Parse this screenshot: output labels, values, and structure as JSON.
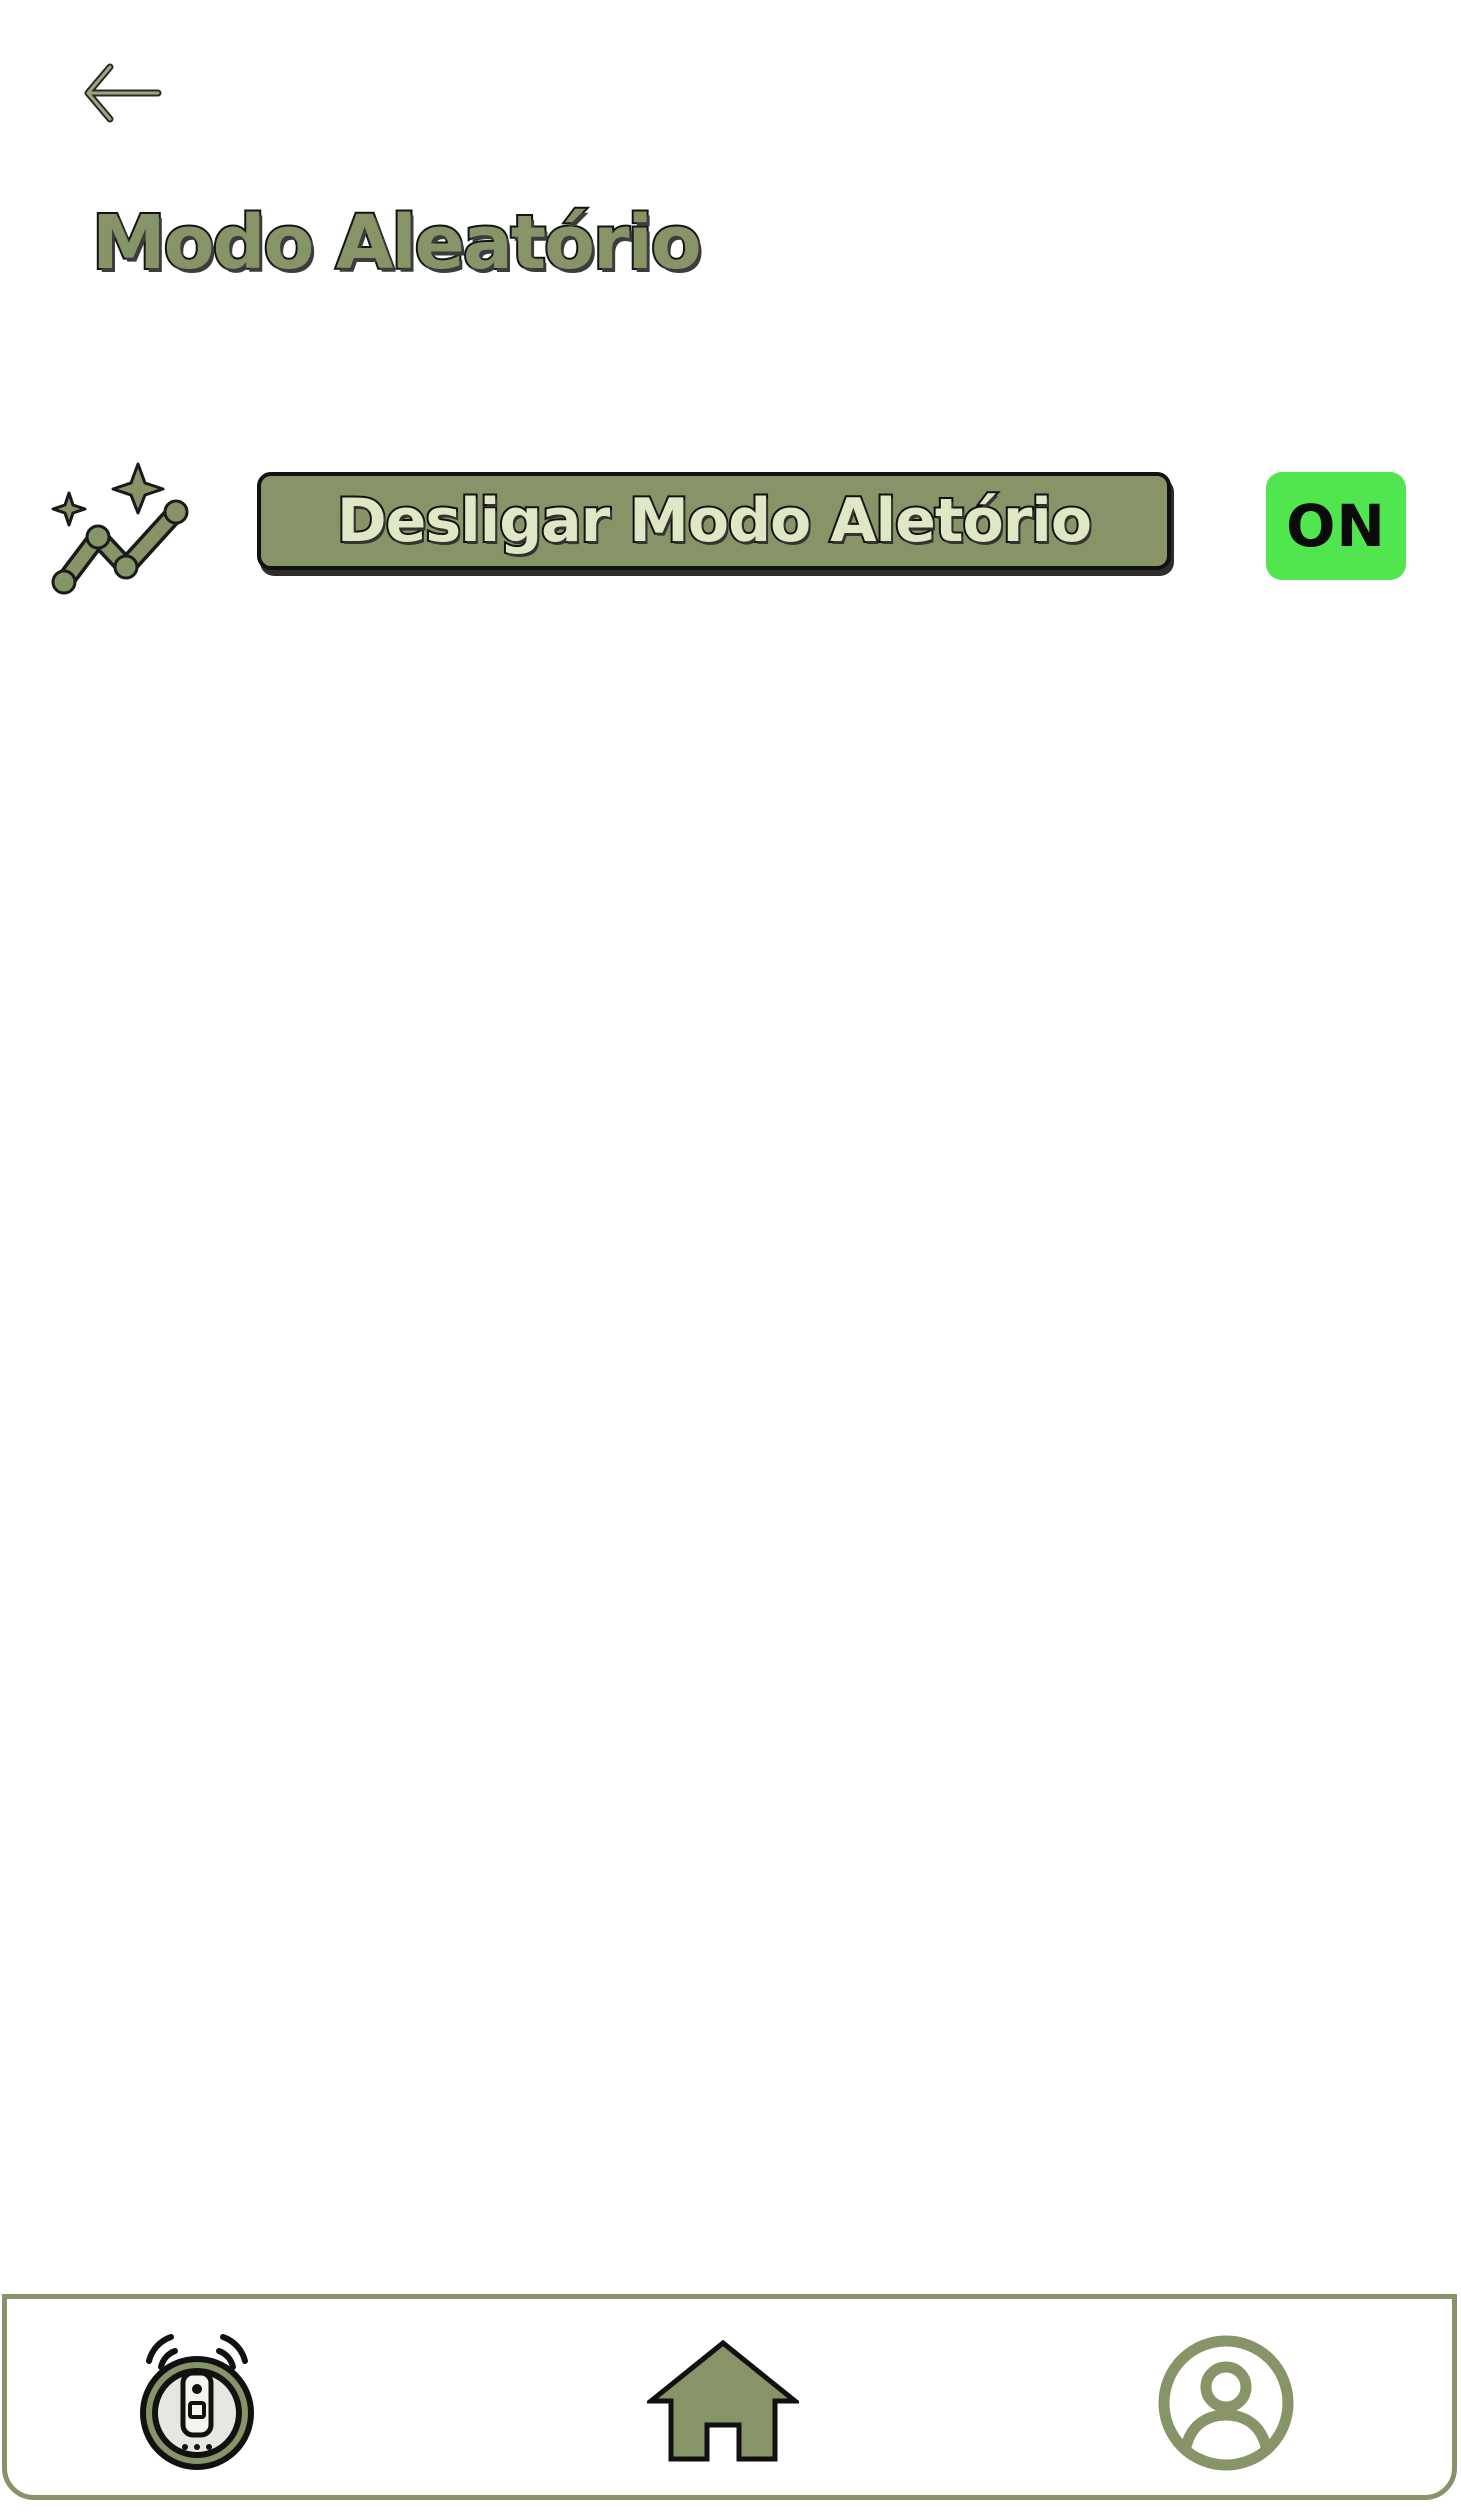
{
  "header": {
    "back_icon": "arrow-left-icon",
    "title": "Modo Aleatório"
  },
  "mode_row": {
    "icon": "random-path-sparkle-icon",
    "button_label": "Desligar Modo Aletório",
    "status_label": "ON"
  },
  "bottom_nav": {
    "items": [
      {
        "icon": "robot-vacuum-icon"
      },
      {
        "icon": "home-icon"
      },
      {
        "icon": "profile-icon"
      }
    ]
  },
  "colors": {
    "accent": "#869467",
    "button_text": "#dfe7c4",
    "status_on": "#51e64f",
    "outline": "#111111"
  }
}
